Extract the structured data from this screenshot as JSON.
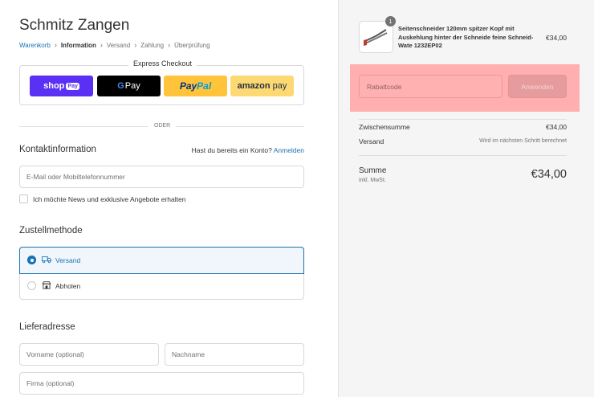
{
  "shop": {
    "title": "Schmitz Zangen"
  },
  "breadcrumb": {
    "items": [
      "Warenkorb",
      "Information",
      "Versand",
      "Zahlung",
      "Überprüfung"
    ]
  },
  "express": {
    "label": "Express Checkout",
    "buttons": {
      "shop_pay": {
        "word": "shop",
        "pill": "Pay",
        "color": "#5a31f4"
      },
      "google_pay": {
        "g": "G",
        "text": "Pay",
        "color": "#000000"
      },
      "paypal": {
        "pay": "Pay",
        "pal": "Pal",
        "color": "#ffc439"
      },
      "amazon_pay": {
        "amazon": "amazon",
        "pay": "pay",
        "color": "#fdd974"
      }
    }
  },
  "divider": {
    "text": "ODER"
  },
  "contact": {
    "heading": "Kontaktinformation",
    "login_prompt": "Hast du bereits ein Konto?",
    "login_link": "Anmelden",
    "email_placeholder": "E-Mail oder Mobiltelefonnummer",
    "newsletter_label": "Ich möchte News und exklusive Angebote erhalten"
  },
  "delivery": {
    "heading": "Zustellmethode",
    "options": [
      {
        "label": "Versand",
        "selected": true,
        "icon": "truck-icon"
      },
      {
        "label": "Abholen",
        "selected": false,
        "icon": "store-icon"
      }
    ]
  },
  "address": {
    "heading": "Lieferadresse",
    "firstname_placeholder": "Vorname (optional)",
    "lastname_placeholder": "Nachname",
    "company_placeholder": "Firma (optional)"
  },
  "summary": {
    "product": {
      "quantity": "1",
      "name": "Seitenschneider 120mm spitzer Kopf mit Auskehlung hinter der Schneide feine Schneid-Wate 1232EP02",
      "price": "€34,00"
    },
    "discount": {
      "placeholder": "Rabattcode",
      "button": "Anwenden",
      "highlight_color": "#ffafaf"
    },
    "subtotal": {
      "label": "Zwischensumme",
      "value": "€34,00"
    },
    "shipping": {
      "label": "Versand",
      "value": "Wird im nächsten Schritt berechnet"
    },
    "total": {
      "label": "Summe",
      "sub": "inkl. MwSt.",
      "value": "€34,00"
    }
  },
  "colors": {
    "accent": "#1a73b5",
    "sidebar_bg": "#f5f5f5"
  }
}
